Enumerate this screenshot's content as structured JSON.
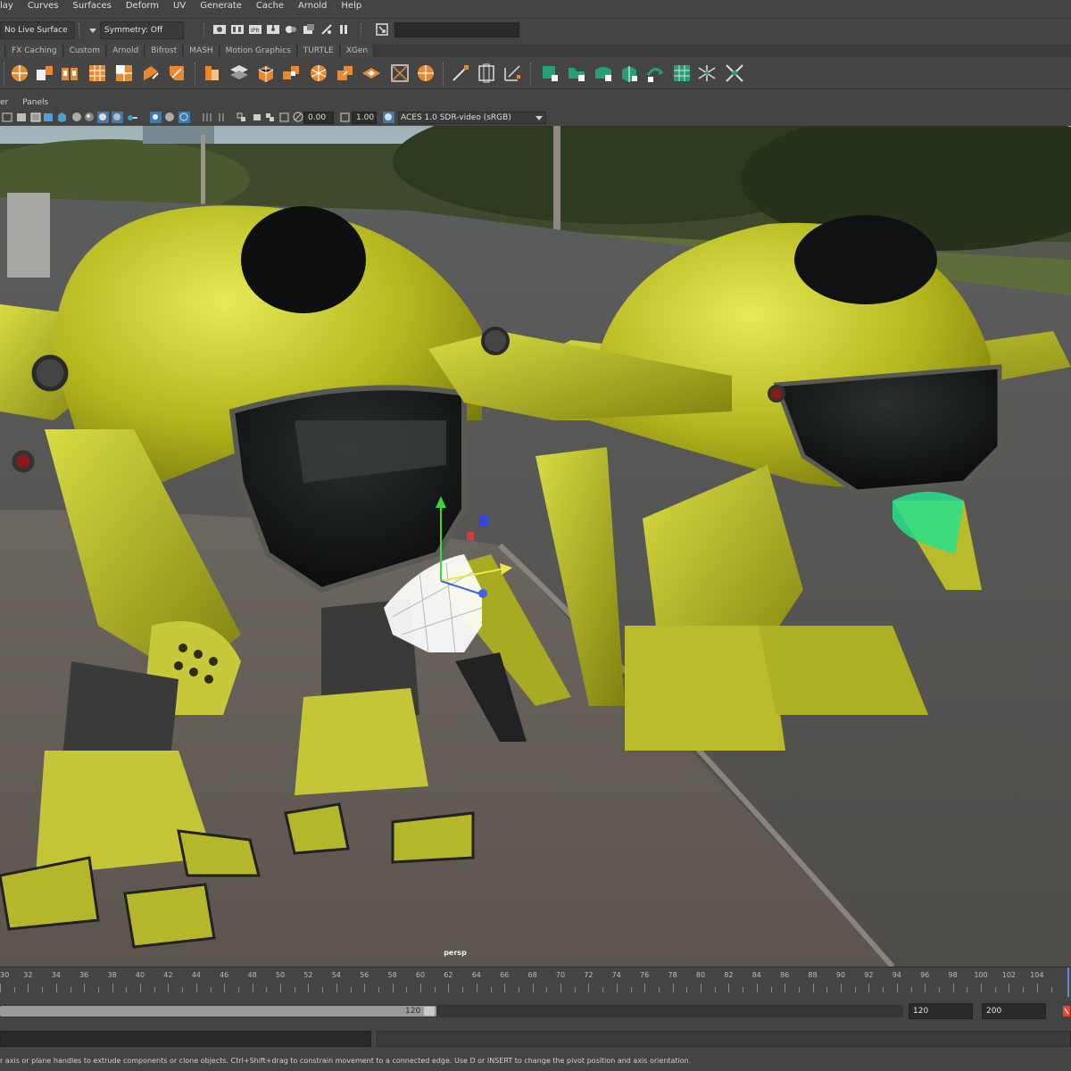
{
  "menubar": {
    "items": [
      "lay",
      "Curves",
      "Surfaces",
      "Deform",
      "UV",
      "Generate",
      "Cache",
      "Arnold",
      "Help"
    ]
  },
  "statusline": {
    "live_surface": "No Live Surface",
    "symmetry": "Symmetry: Off"
  },
  "shelf": {
    "tabs": [
      "FX Caching",
      "Custom",
      "Arnold",
      "Bifrost",
      "MASH",
      "Motion Graphics",
      "TURTLE",
      "XGen"
    ]
  },
  "panel_menu": {
    "items": [
      "er",
      "Panels"
    ]
  },
  "panel_toolbar": {
    "exposure": "0.00",
    "gamma": "1.00",
    "color_space": "ACES 1.0 SDR-video (sRGB)"
  },
  "viewport": {
    "camera": "persp"
  },
  "timeline": {
    "ticks": [
      "30",
      "32",
      "34",
      "36",
      "38",
      "40",
      "42",
      "44",
      "46",
      "48",
      "50",
      "52",
      "54",
      "56",
      "58",
      "60",
      "62",
      "64",
      "66",
      "68",
      "70",
      "72",
      "74",
      "76",
      "78",
      "80",
      "82",
      "84",
      "86",
      "88",
      "90",
      "92",
      "94",
      "96",
      "98",
      "100",
      "102",
      "104"
    ]
  },
  "range": {
    "playback_end": "120",
    "end_field": "120",
    "anim_end_field": "200"
  },
  "helpline": {
    "text": "r axis or plane handles to extrude components or clone objects. Ctrl+Shift+drag to constrain movement to a connected edge. Use D or INSERT to change the pivot position and axis orientation."
  },
  "icons": {
    "shelf": [
      "poly-sphere-icon",
      "poly-cube-icon",
      "poly-cylinder-icon",
      "poly-grid-icon",
      "combine-icon",
      "separate-icon",
      "bevel-icon",
      "extrude-icon",
      "bridge-icon",
      "mirror-icon",
      "smooth-icon",
      "boolean-icon",
      "bend-icon",
      "fill-hole-icon",
      "multicut-icon",
      "quad-draw-icon",
      "target-weld-icon",
      "uv-editor-icon",
      "planar-map-icon",
      "auto-uv-icon",
      "unfold-icon",
      "layout-uv-icon",
      "sew-uv-icon",
      "cut-uv-icon",
      "pin-uv-icon",
      "grid-uv-icon",
      "straighten-icon"
    ]
  }
}
